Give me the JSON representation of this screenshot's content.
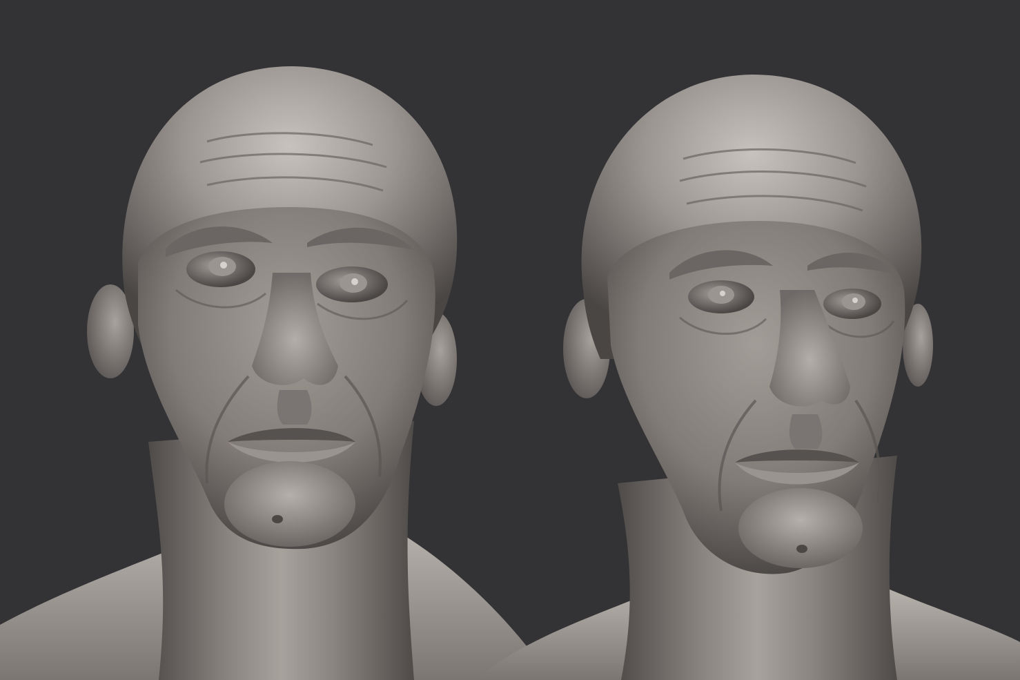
{
  "scene": {
    "background_color": "#333335",
    "clay_color": "#8d8885",
    "clay_highlight": "#cbc6c1",
    "clay_shadow": "#3e3a39"
  },
  "busts": [
    {
      "view": "front"
    },
    {
      "view": "three-quarter"
    }
  ]
}
